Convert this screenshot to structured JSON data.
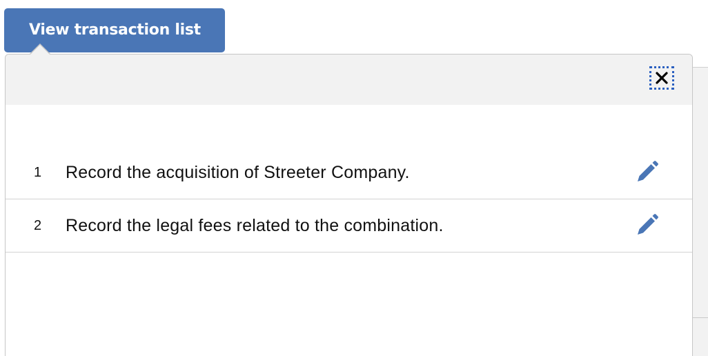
{
  "toolbar": {
    "view_transaction_list_label": "View transaction list"
  },
  "popup": {
    "close_icon": "close-x-icon",
    "close_focus_color": "#2a5fc0"
  },
  "transactions": [
    {
      "number": "1",
      "description": "Record the acquisition of Streeter Company.",
      "action_icon": "pencil-edit-icon"
    },
    {
      "number": "2",
      "description": "Record the legal fees related to the combination.",
      "action_icon": "pencil-edit-icon"
    }
  ],
  "colors": {
    "button_background": "#4a76b6",
    "header_background": "#f2f2f2",
    "edit_icon": "#4a76b6"
  }
}
